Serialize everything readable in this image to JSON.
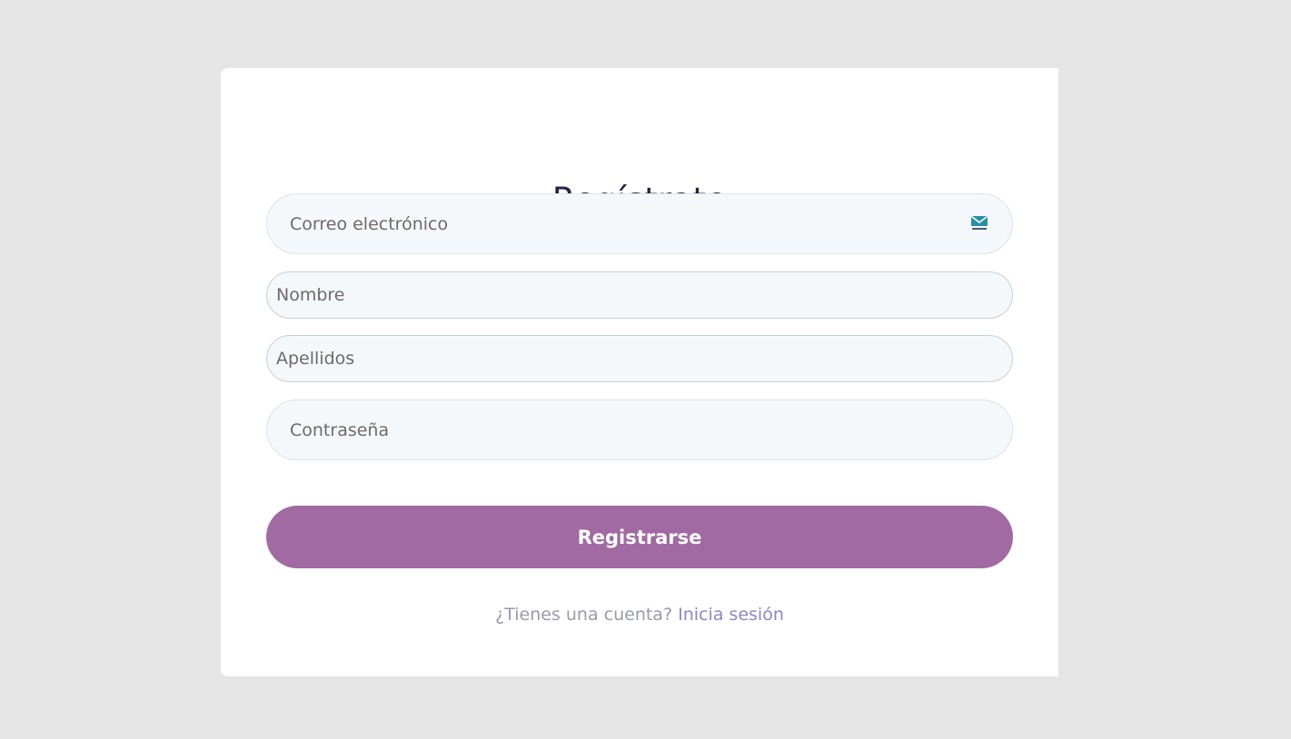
{
  "form": {
    "title": "Regístrate",
    "email": {
      "placeholder": "Correo electrónico",
      "value": ""
    },
    "nombre": {
      "placeholder": "Nombre",
      "value": ""
    },
    "apellidos": {
      "placeholder": "Apellidos",
      "value": ""
    },
    "password": {
      "placeholder": "Contraseña",
      "value": ""
    },
    "email_icon": "mail-icon",
    "submit_label": "Registrarse"
  },
  "footer": {
    "prompt": "¿Tienes una cuenta?",
    "link_label": "Inicia sesión"
  },
  "colors": {
    "page_background": "#e5e5e5",
    "card_background": "#ffffff",
    "title": "#24244a",
    "button": "#a16aa3",
    "link": "#8b87c8"
  }
}
